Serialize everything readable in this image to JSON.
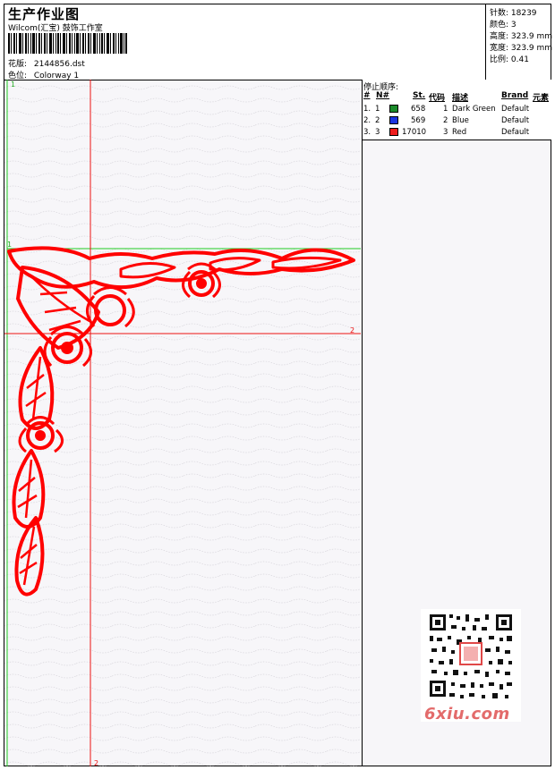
{
  "header": {
    "title": "生产作业图",
    "studio": "Wilcom(汇宝) 鼓饰工作室",
    "design_label": "花版:",
    "design_value": "2144856.dst",
    "colorway_label": "色位:",
    "colorway_value": "Colorway 1"
  },
  "stats": {
    "stitches": "针数: 18239",
    "colors": "颜色: 3",
    "height": "高度: 323.9 mm",
    "width": "宽度: 323.9 mm",
    "scale": "比例: 0.41"
  },
  "stop_sequence": {
    "title": "停止顺序:",
    "headers": [
      "#",
      "N#",
      "St.",
      "代码",
      "描述",
      "Brand",
      "元素"
    ],
    "rows": [
      {
        "index": "1.",
        "needle": "1",
        "color": "#1a8a2a",
        "stitches": "658",
        "code": "1",
        "desc": "Dark Green",
        "brand": "Default"
      },
      {
        "index": "2.",
        "needle": "2",
        "color": "#1c34e0",
        "stitches": "569",
        "code": "2",
        "desc": "Blue",
        "brand": "Default"
      },
      {
        "index": "3.",
        "needle": "3",
        "color": "#ee1c1c",
        "stitches": "17010",
        "code": "3",
        "desc": "Red",
        "brand": "Default"
      }
    ]
  },
  "canvas": {
    "guide_green_label": "1",
    "guide_red_label": "2",
    "guide_green_color": "#22cc22",
    "guide_red_color": "#ee1111",
    "design_color": "#ff0000"
  },
  "watermark": "6xiu.com"
}
